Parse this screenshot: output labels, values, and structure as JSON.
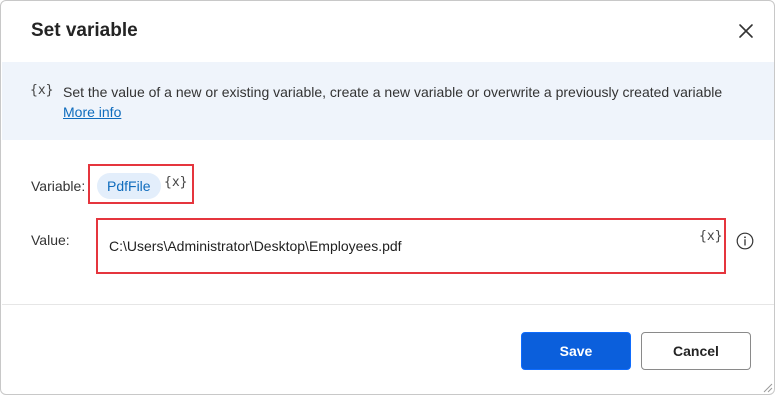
{
  "dialog": {
    "title": "Set variable",
    "close_icon": "close-icon"
  },
  "info": {
    "icon_text": "{x}",
    "description": "Set the value of a new or existing variable, create a new variable or overwrite a previously created variable",
    "link_text": "More info"
  },
  "variable": {
    "label": "Variable:",
    "name": "PdfFile",
    "picker_text": "{x}"
  },
  "value": {
    "label": "Value:",
    "text": "C:\\Users\\Administrator\\Desktop\\Employees.pdf",
    "picker_text": "{x}",
    "help_icon": "info-circle-icon"
  },
  "buttons": {
    "save_label": "Save",
    "cancel_label": "Cancel"
  },
  "colors": {
    "accent": "#0b5fdc",
    "highlight_border": "#e5353d",
    "banner_bg": "#eff4fb",
    "pill_bg": "#e3eefb",
    "link": "#0f6cbd"
  }
}
